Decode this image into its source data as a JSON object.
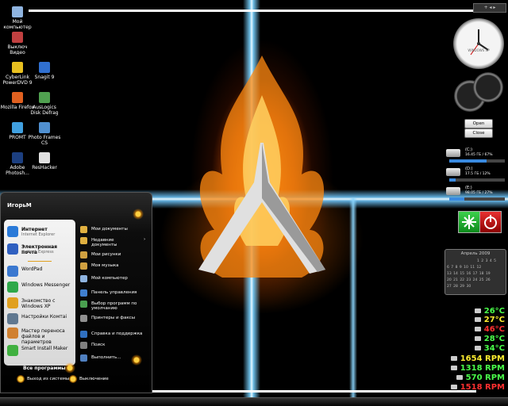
{
  "desktop": {
    "icons": [
      {
        "label": "Мой компьютер",
        "color": "#8fb4e0"
      },
      {
        "label": "Выключ Видео",
        "color": "#c04040"
      },
      {
        "label": "CyberLink PowerDVD 9",
        "color": "#e8c020"
      },
      {
        "label": "Snagit 9",
        "color": "#3070d0"
      },
      {
        "label": "Mozilla Firefox",
        "color": "#e06020"
      },
      {
        "label": "AusLogics Disk Defrag",
        "color": "#50a050"
      },
      {
        "label": "PROMT",
        "color": "#40a0e0"
      },
      {
        "label": "Photo Frames CS",
        "color": "#5090d0"
      },
      {
        "label": "Adobe Photosh...",
        "color": "#1c3f80"
      },
      {
        "label": "ResHacker",
        "color": "#e0e0e0"
      }
    ]
  },
  "start_menu": {
    "user_name": "ИгорьМ",
    "pinned": [
      {
        "title": "Интернет",
        "subtitle": "Internet Explorer",
        "color": "#2a7ad8"
      },
      {
        "title": "Электронная почта",
        "subtitle": "Outlook Express",
        "color": "#3060c0"
      }
    ],
    "recent": [
      {
        "title": "WordPad",
        "color": "#3a78d0"
      },
      {
        "title": "Windows Messenger",
        "color": "#2fa84a"
      },
      {
        "title": "Знакомство с Windows XP",
        "color": "#e0a020"
      },
      {
        "title": "Настройки Комтаi",
        "color": "#607890"
      },
      {
        "title": "Мастер переноса файлов и параметров",
        "color": "#d08030"
      },
      {
        "title": "Smart Install Maker",
        "color": "#40b040"
      }
    ],
    "all_programs": "Все программы",
    "right_items": [
      {
        "title": "Мои документы",
        "color": "#e0b040"
      },
      {
        "title": "Недавние документы",
        "color": "#e0b040",
        "arrow": "›"
      },
      {
        "title": "Мои рисунки",
        "color": "#d0a040"
      },
      {
        "title": "Моя музыка",
        "color": "#d0a040"
      },
      {
        "title": "Мой компьютер",
        "color": "#8fb4e0"
      },
      {
        "title": "Панель управления",
        "color": "#4080d0"
      },
      {
        "title": "Выбор программ по умолчанию",
        "color": "#4aa050"
      },
      {
        "title": "Принтеры и факсы",
        "color": "#909090"
      },
      {
        "title": "Справка и поддержка",
        "color": "#3070c0"
      },
      {
        "title": "Поиск",
        "color": "#808080"
      },
      {
        "title": "Выполнить...",
        "color": "#5080c0"
      }
    ],
    "logoff_label": "Выход из системы",
    "shutdown_label": "Выключение"
  },
  "gadgets": {
    "clock_brand": "WINDOWS XP",
    "open_label": "Open",
    "close_label": "Close",
    "drives": [
      {
        "label": "(C:)",
        "info": "16.45 ГБ / 67%",
        "used": 0.67
      },
      {
        "label": "(D:)",
        "info": "17.5 ГБ / 12%",
        "used": 0.12
      },
      {
        "label": "(E:)",
        "info": "98.05 ГБ / 27%",
        "used": 0.27
      }
    ],
    "calendar": {
      "header": "Апрель 2009",
      "rows": [
        "1 2 3 4 5",
        "6 7 8 9 10 11 12",
        "13 14 15 16 17 18 19",
        "20 21 22 23 24 25 26",
        "27 28 29 30"
      ]
    },
    "sensors": [
      {
        "value": "26°C",
        "color": "#4aff4a"
      },
      {
        "value": "27°C",
        "color": "#ffee30"
      },
      {
        "value": "46°C",
        "color": "#ff3030"
      },
      {
        "value": "28°C",
        "color": "#4aff4a"
      },
      {
        "value": "34°C",
        "color": "#4aff4a"
      },
      {
        "value": "1654 RPM",
        "color": "#ffee30"
      },
      {
        "value": "1318 RPM",
        "color": "#4aff4a"
      },
      {
        "value": "570 RPM",
        "color": "#4aff4a"
      },
      {
        "value": "1518 RPM",
        "color": "#ff3030"
      }
    ]
  }
}
